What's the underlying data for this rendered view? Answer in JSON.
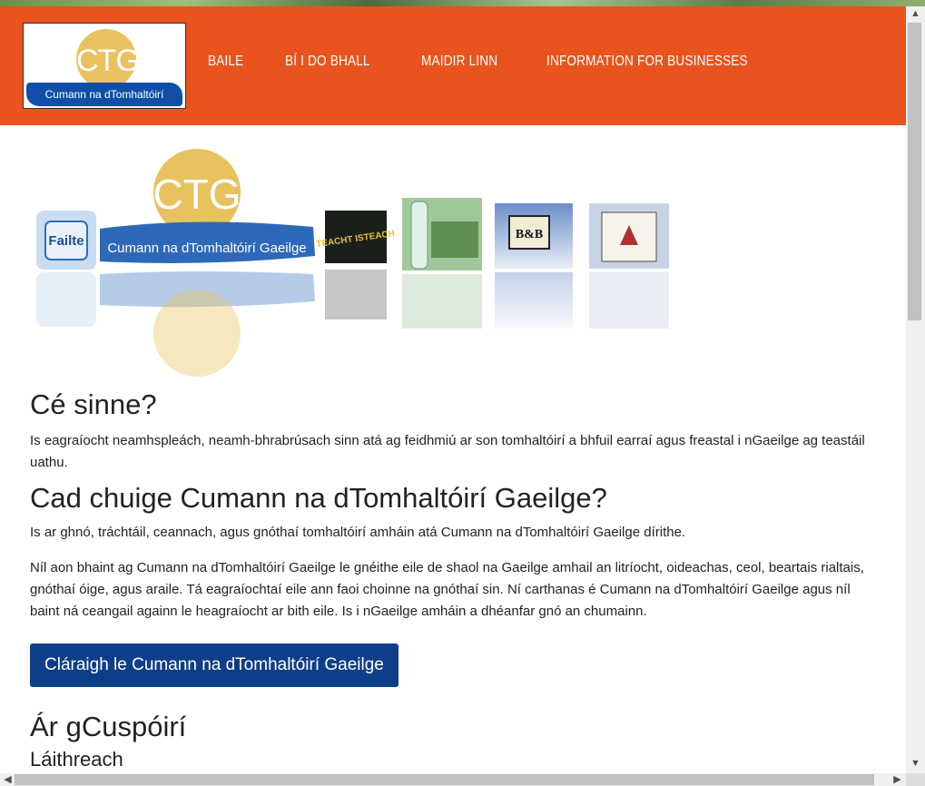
{
  "logo": {
    "mark_text": "CTG",
    "org_name": "Cumann na dTomhaltóirí Gaeilge"
  },
  "nav": {
    "items": [
      "BAILE",
      "BÍ I DO BHALL",
      "MAIDIR LINN",
      "INFORMATION FOR BUSINESSES"
    ]
  },
  "banner": {
    "ctg_text": "CTG",
    "org_name": "Cumann na dTomhaltóirí Gaeilge",
    "failte_text": "Failte",
    "teacht_text": "TEACHT ISTEACH",
    "bnb_text": "B&B"
  },
  "sections": {
    "who_heading": "Cé sinne?",
    "who_text": "Is eagraíocht neamhspleách, neamh-bhrabrúsach sinn atá ag feidhmiú ar son tomhaltóirí a bhfuil earraí agus freastal i nGaeilge ag teastáil uathu.",
    "why_heading": "Cad chuige Cumann na dTomhaltóirí Gaeilge?",
    "why_text_1": "Is ar ghnó, tráchtáil, ceannach, agus gnóthaí tomhaltóirí amháin atá Cumann na dTomhaltóirí Gaeilge dírithe.",
    "why_text_2": "Níl aon bhaint ag Cumann na dTomhaltóirí Gaeilge le gnéithe eile de shaol na Gaeilge amhail an litríocht, oideachas, ceol, beartais rialtais, gnóthaí óige, agus araile. Tá eagraíochtaí eile ann faoi choinne na gnóthaí sin. Ní carthanas é Cumann na dTomhaltóirí Gaeilge agus níl baint ná ceangail againn le heagraíocht ar bith eile. Is i nGaeilge amháin a dhéanfar gnó an chumainn.",
    "register_button": "Cláraigh le Cumann na dTomhaltóirí Gaeilge",
    "aims_heading": "Ár gCuspóirí",
    "aims_sub": "Láithreach"
  },
  "colors": {
    "header_bg": "#e9531d",
    "button_bg": "#0e3e87",
    "logo_gold": "#e8c25e",
    "logo_blue": "#0f4fa8"
  }
}
